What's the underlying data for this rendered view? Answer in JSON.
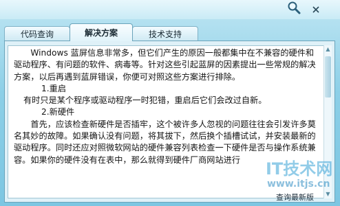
{
  "toolbar": {
    "search_icon": "magnifier-icon",
    "close_icon": "close-icon"
  },
  "tabs": [
    {
      "label": "代码查询",
      "active": false
    },
    {
      "label": "解决方案",
      "active": true
    },
    {
      "label": "技术支持",
      "active": false
    }
  ],
  "content": {
    "paragraphs": [
      "Windows 蓝屏信息非常多，但它们产生的原因一般都集中在不兼容的硬件和驱动程序、有问题的软件、病毒等。针对这些引起蓝屏的因素提出一些常规的解决方案，以后再遇到蓝屏错误，你便可对照这些方案进行排除。",
      "1.重启",
      "有时只是某个程序或驱动程序一时犯错，重启后它们会改过自新。",
      "2.新硬件",
      "首先，应该检查新硬件是否插牢，这个被许多人忽视的问题往往会引发许多莫名其妙的故障。如果确认没有问题，将其拔下，然后换个插槽试试，并安装最新的驱动程序。同时还应对照微软网站的硬件兼容列表检查一下硬件是否与操作系统兼容。如果你的硬件没有在表中，那么就得到硬件厂商网站进行"
    ]
  },
  "footer": {
    "update_link": "查询最新版"
  },
  "watermark": {
    "main": "IT技术网",
    "sub": "www.itjs.cn"
  },
  "colors": {
    "background": "#8ccfe7",
    "panel": "#dff1f8",
    "watermark": "#3aa3d7"
  }
}
